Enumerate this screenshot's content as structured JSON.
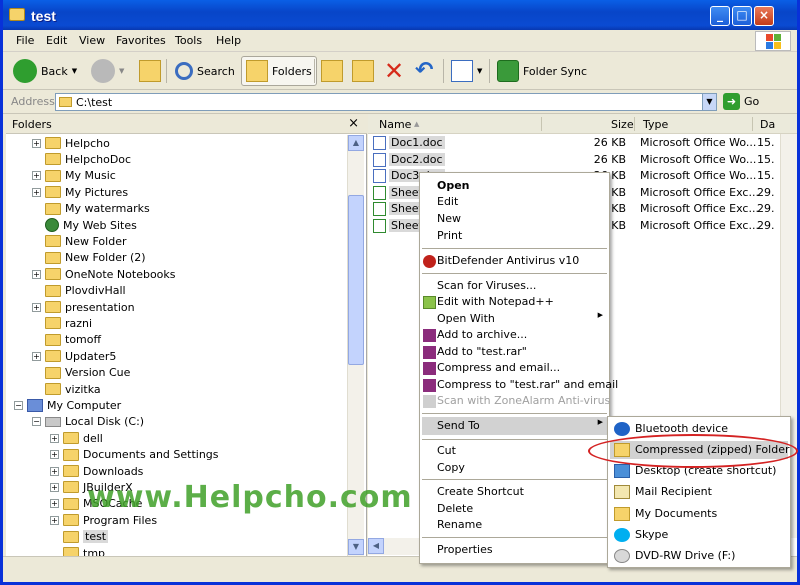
{
  "window": {
    "title": "test"
  },
  "menubar": {
    "items": [
      "File",
      "Edit",
      "View",
      "Favorites",
      "Tools",
      "Help"
    ]
  },
  "toolbar": {
    "back_label": "Back",
    "search_label": "Search",
    "folders_label": "Folders",
    "foldersync_label": "Folder Sync"
  },
  "address": {
    "label": "Address",
    "value": "C:\\test",
    "go_label": "Go"
  },
  "left_pane": {
    "title": "Folders",
    "close_glyph": "×",
    "tree": [
      {
        "label": "Helpcho",
        "expand": "+"
      },
      {
        "label": "HelpchoDoc",
        "expand": ""
      },
      {
        "label": "My Music",
        "expand": "+"
      },
      {
        "label": "My Pictures",
        "expand": "+"
      },
      {
        "label": "My watermarks",
        "expand": ""
      },
      {
        "label": "My Web Sites",
        "expand": ""
      },
      {
        "label": "New Folder",
        "expand": ""
      },
      {
        "label": "New Folder (2)",
        "expand": ""
      },
      {
        "label": "OneNote Notebooks",
        "expand": "+"
      },
      {
        "label": "PlovdivHall",
        "expand": ""
      },
      {
        "label": "presentation",
        "expand": "+"
      },
      {
        "label": "razni",
        "expand": ""
      },
      {
        "label": "tomoff",
        "expand": ""
      },
      {
        "label": "Updater5",
        "expand": "+"
      },
      {
        "label": "Version Cue",
        "expand": ""
      },
      {
        "label": "vizitka",
        "expand": ""
      },
      {
        "label": "My Computer",
        "expand": "−"
      },
      {
        "label": "Local Disk (C:)",
        "expand": "−"
      },
      {
        "label": "dell",
        "expand": "+"
      },
      {
        "label": "Documents and Settings",
        "expand": "+"
      },
      {
        "label": "Downloads",
        "expand": "+"
      },
      {
        "label": "JBuilderX",
        "expand": "+"
      },
      {
        "label": "MSOCache",
        "expand": "+"
      },
      {
        "label": "Program Files",
        "expand": "+"
      },
      {
        "label": "test",
        "expand": ""
      },
      {
        "label": "tmp",
        "expand": ""
      }
    ]
  },
  "right_pane": {
    "columns": {
      "name": "Name",
      "size": "Size",
      "type": "Type",
      "date": "Da"
    },
    "files": [
      {
        "name": "Doc1.doc",
        "size": "26 KB",
        "type": "Microsoft Office Wo...",
        "date": "15.",
        "kind": "doc"
      },
      {
        "name": "Doc2.doc",
        "size": "26 KB",
        "type": "Microsoft Office Wo...",
        "date": "15.",
        "kind": "doc"
      },
      {
        "name": "Doc3.doc",
        "size": "26 KB",
        "type": "Microsoft Office Wo...",
        "date": "15.",
        "kind": "doc"
      },
      {
        "name": "Sheet1",
        "size": "KB",
        "type": "Microsoft Office Exc...",
        "date": "29.",
        "kind": "xls"
      },
      {
        "name": "Sheet2",
        "size": "KB",
        "type": "Microsoft Office Exc...",
        "date": "29.",
        "kind": "xls"
      },
      {
        "name": "Sheet3",
        "size": "KB",
        "type": "Microsoft Office Exc...",
        "date": "29.",
        "kind": "xls"
      }
    ]
  },
  "context_menu": {
    "open": "Open",
    "edit": "Edit",
    "new": "New",
    "print": "Print",
    "bitdefender": "BitDefender Antivirus v10",
    "scan": "Scan for Viruses...",
    "notepad": "Edit with Notepad++",
    "open_with": "Open With",
    "add_archive": "Add to archive...",
    "add_rar": "Add to \"test.rar\"",
    "compress_email": "Compress and email...",
    "compress_rar_email": "Compress to \"test.rar\" and email",
    "zonealarm": "Scan with ZoneAlarm Anti-virus",
    "send_to": "Send To",
    "cut": "Cut",
    "copy": "Copy",
    "create_shortcut": "Create Shortcut",
    "delete": "Delete",
    "rename": "Rename",
    "properties": "Properties"
  },
  "send_to_menu": {
    "items": [
      "Bluetooth device",
      "Compressed (zipped) Folder",
      "Desktop (create shortcut)",
      "Mail Recipient",
      "My Documents",
      "Skype",
      "DVD-RW Drive (F:)"
    ]
  },
  "watermark": {
    "text": "www.Helpcho.com"
  },
  "colors": {
    "title_blue": "#0a4bd2",
    "highlight_red": "#d42323",
    "watermark_green": "#40a028"
  }
}
